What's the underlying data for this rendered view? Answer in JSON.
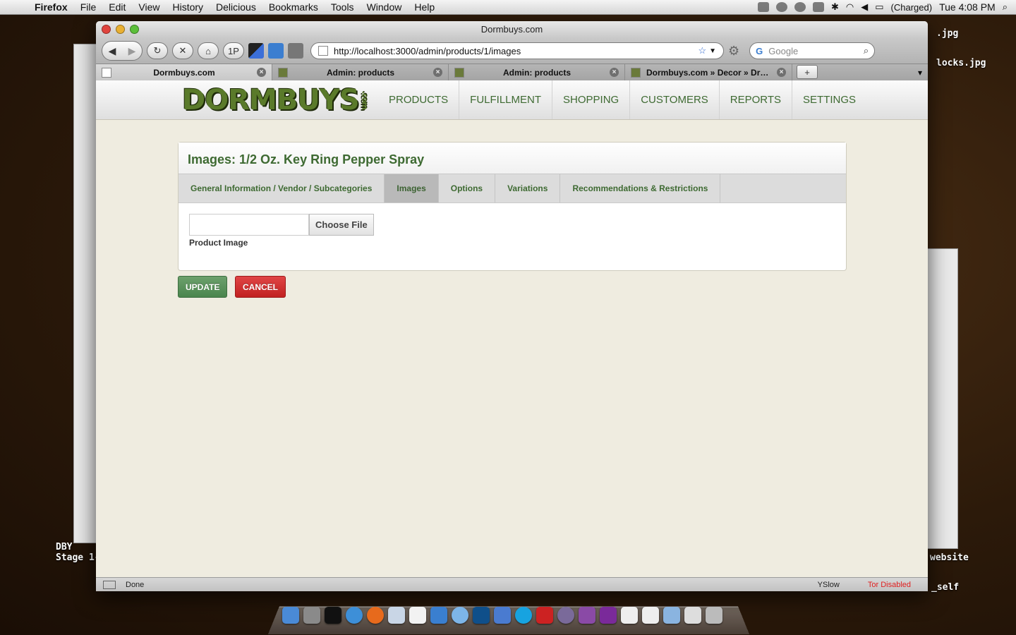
{
  "menubar": {
    "app": "Firefox",
    "items": [
      "File",
      "Edit",
      "View",
      "History",
      "Delicious",
      "Bookmarks",
      "Tools",
      "Window",
      "Help"
    ],
    "battery": "(Charged)",
    "clock": "Tue 4:08 PM"
  },
  "desktop": {
    "file1": ".jpg",
    "file2": "locks.jpg",
    "file3": "website",
    "file4": "_self",
    "file5": "DBY",
    "file6": "Stage 1-"
  },
  "browser": {
    "window_title": "Dormbuys.com",
    "url": "http://localhost:3000/admin/products/1/images",
    "search_placeholder": "Google",
    "onep": "1P",
    "tabs": [
      {
        "label": "Dormbuys.com"
      },
      {
        "label": "Admin: products"
      },
      {
        "label": "Admin: products"
      },
      {
        "label": "Dormbuys.com » Decor » Dry E..."
      }
    ],
    "status": "Done",
    "yslow": "YSlow",
    "tor": "Tor Disabled"
  },
  "site": {
    "logo": "DORMBUYS",
    "logo_suffix": ".com",
    "nav": [
      "PRODUCTS",
      "FULFILLMENT",
      "SHOPPING",
      "CUSTOMERS",
      "REPORTS",
      "SETTINGS"
    ]
  },
  "panel": {
    "title": "Images: 1/2 Oz. Key Ring Pepper Spray",
    "tabs": [
      "General Information / Vendor / Subcategories",
      "Images",
      "Options",
      "Variations",
      "Recommendations & Restrictions"
    ],
    "choose_file": "Choose File",
    "field_label": "Product Image",
    "update": "UPDATE",
    "cancel": "CANCEL"
  },
  "colors": {
    "accent_green": "#3e6a32",
    "update": "#4a854d",
    "cancel": "#c12121",
    "tor": "#e02020"
  }
}
